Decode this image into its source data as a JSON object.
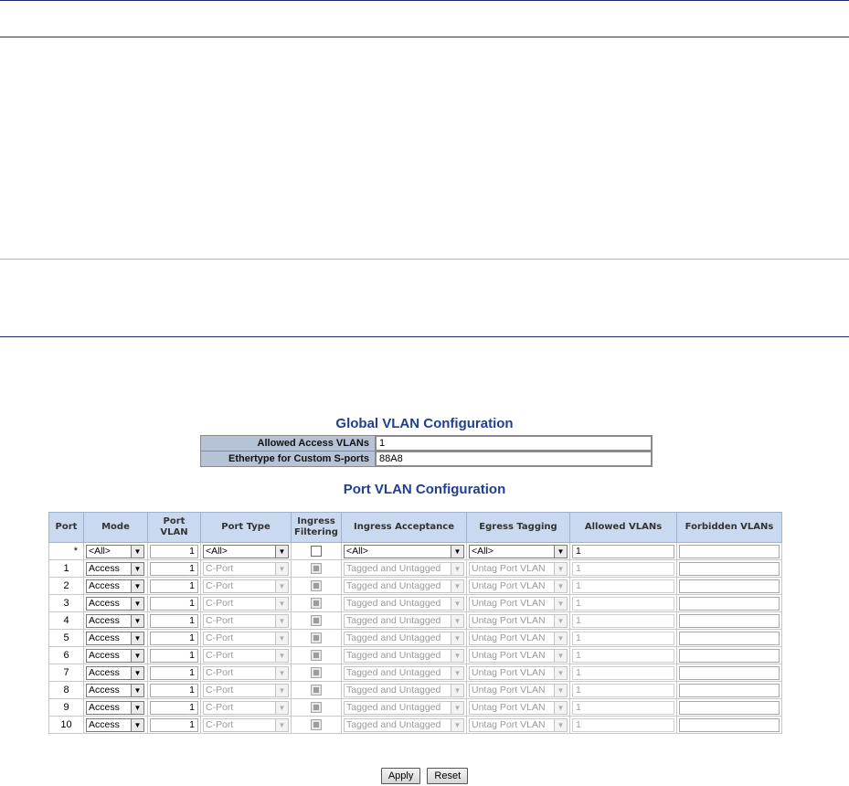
{
  "global": {
    "title": "Global VLAN Configuration",
    "allowed_access_label": "Allowed Access VLANs",
    "allowed_access_value": "1",
    "ethertype_label": "Ethertype for Custom S-ports",
    "ethertype_value": "88A8"
  },
  "port": {
    "title": "Port VLAN Configuration",
    "headers": {
      "port": "Port",
      "mode": "Mode",
      "port_vlan": "Port VLAN",
      "port_type": "Port Type",
      "ingress_filtering": "Ingress Filtering",
      "ingress_acceptance": "Ingress Acceptance",
      "egress_tagging": "Egress Tagging",
      "allowed_vlans": "Allowed VLANs",
      "forbidden_vlans": "Forbidden VLANs"
    },
    "star_row": {
      "port": "*",
      "mode": "<All>",
      "port_vlan": "1",
      "port_type": "<All>",
      "ingress_acceptance": "<All>",
      "egress_tagging": "<All>",
      "allowed_vlans": "1",
      "forbidden_vlans": ""
    },
    "rows": [
      {
        "port": "1",
        "mode": "Access",
        "port_vlan": "1",
        "port_type": "C-Port",
        "ingress_acceptance": "Tagged and Untagged",
        "egress_tagging": "Untag Port VLAN",
        "allowed_vlans": "1",
        "forbidden_vlans": ""
      },
      {
        "port": "2",
        "mode": "Access",
        "port_vlan": "1",
        "port_type": "C-Port",
        "ingress_acceptance": "Tagged and Untagged",
        "egress_tagging": "Untag Port VLAN",
        "allowed_vlans": "1",
        "forbidden_vlans": ""
      },
      {
        "port": "3",
        "mode": "Access",
        "port_vlan": "1",
        "port_type": "C-Port",
        "ingress_acceptance": "Tagged and Untagged",
        "egress_tagging": "Untag Port VLAN",
        "allowed_vlans": "1",
        "forbidden_vlans": ""
      },
      {
        "port": "4",
        "mode": "Access",
        "port_vlan": "1",
        "port_type": "C-Port",
        "ingress_acceptance": "Tagged and Untagged",
        "egress_tagging": "Untag Port VLAN",
        "allowed_vlans": "1",
        "forbidden_vlans": ""
      },
      {
        "port": "5",
        "mode": "Access",
        "port_vlan": "1",
        "port_type": "C-Port",
        "ingress_acceptance": "Tagged and Untagged",
        "egress_tagging": "Untag Port VLAN",
        "allowed_vlans": "1",
        "forbidden_vlans": ""
      },
      {
        "port": "6",
        "mode": "Access",
        "port_vlan": "1",
        "port_type": "C-Port",
        "ingress_acceptance": "Tagged and Untagged",
        "egress_tagging": "Untag Port VLAN",
        "allowed_vlans": "1",
        "forbidden_vlans": ""
      },
      {
        "port": "7",
        "mode": "Access",
        "port_vlan": "1",
        "port_type": "C-Port",
        "ingress_acceptance": "Tagged and Untagged",
        "egress_tagging": "Untag Port VLAN",
        "allowed_vlans": "1",
        "forbidden_vlans": ""
      },
      {
        "port": "8",
        "mode": "Access",
        "port_vlan": "1",
        "port_type": "C-Port",
        "ingress_acceptance": "Tagged and Untagged",
        "egress_tagging": "Untag Port VLAN",
        "allowed_vlans": "1",
        "forbidden_vlans": ""
      },
      {
        "port": "9",
        "mode": "Access",
        "port_vlan": "1",
        "port_type": "C-Port",
        "ingress_acceptance": "Tagged and Untagged",
        "egress_tagging": "Untag Port VLAN",
        "allowed_vlans": "1",
        "forbidden_vlans": ""
      },
      {
        "port": "10",
        "mode": "Access",
        "port_vlan": "1",
        "port_type": "C-Port",
        "ingress_acceptance": "Tagged and Untagged",
        "egress_tagging": "Untag Port VLAN",
        "allowed_vlans": "1",
        "forbidden_vlans": ""
      }
    ]
  },
  "buttons": {
    "apply": "Apply",
    "reset": "Reset"
  }
}
